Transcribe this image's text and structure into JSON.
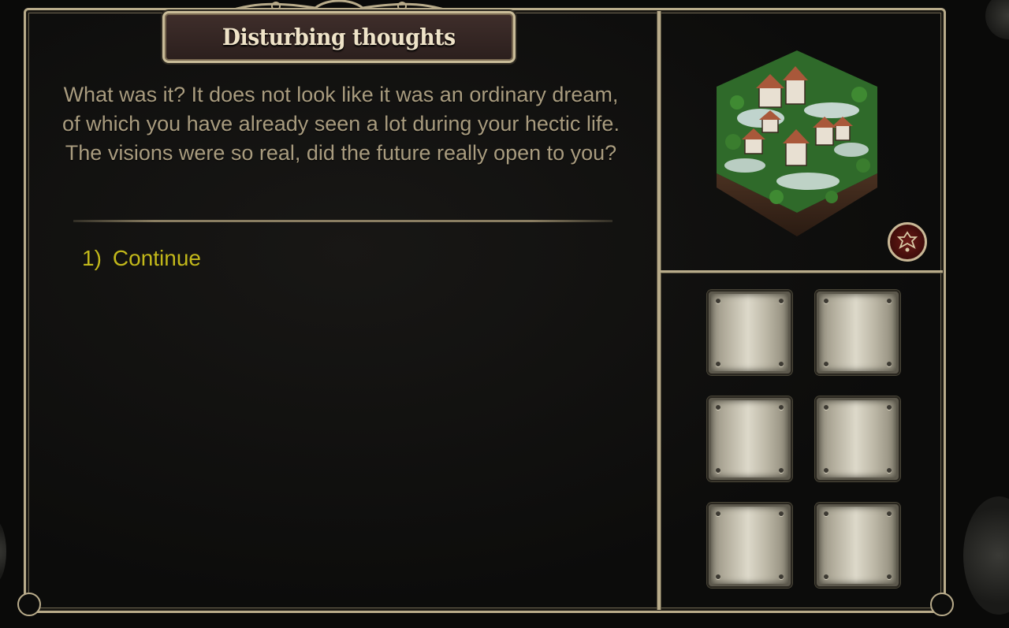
{
  "dialog": {
    "title": "Disturbing thoughts",
    "story_text": "What was it? It does not look like it was an ordinary dream, of which you have already seen a lot during your hectic life. The visions were so real, did the future really open to you?",
    "options": [
      {
        "number": "1)",
        "label": "Continue"
      }
    ]
  },
  "side_panel": {
    "location_icon": "village-tile-icon",
    "crest_button_icon": "crest-emblem-icon",
    "inventory_slots": [
      "empty",
      "empty",
      "empty",
      "empty",
      "empty",
      "empty"
    ]
  },
  "colors": {
    "frame_border": "#b8ab8a",
    "story_text": "#a99c7f",
    "option_text": "#c2b81a",
    "title_text": "#efe3c8",
    "crest_red": "#6a1a16"
  }
}
